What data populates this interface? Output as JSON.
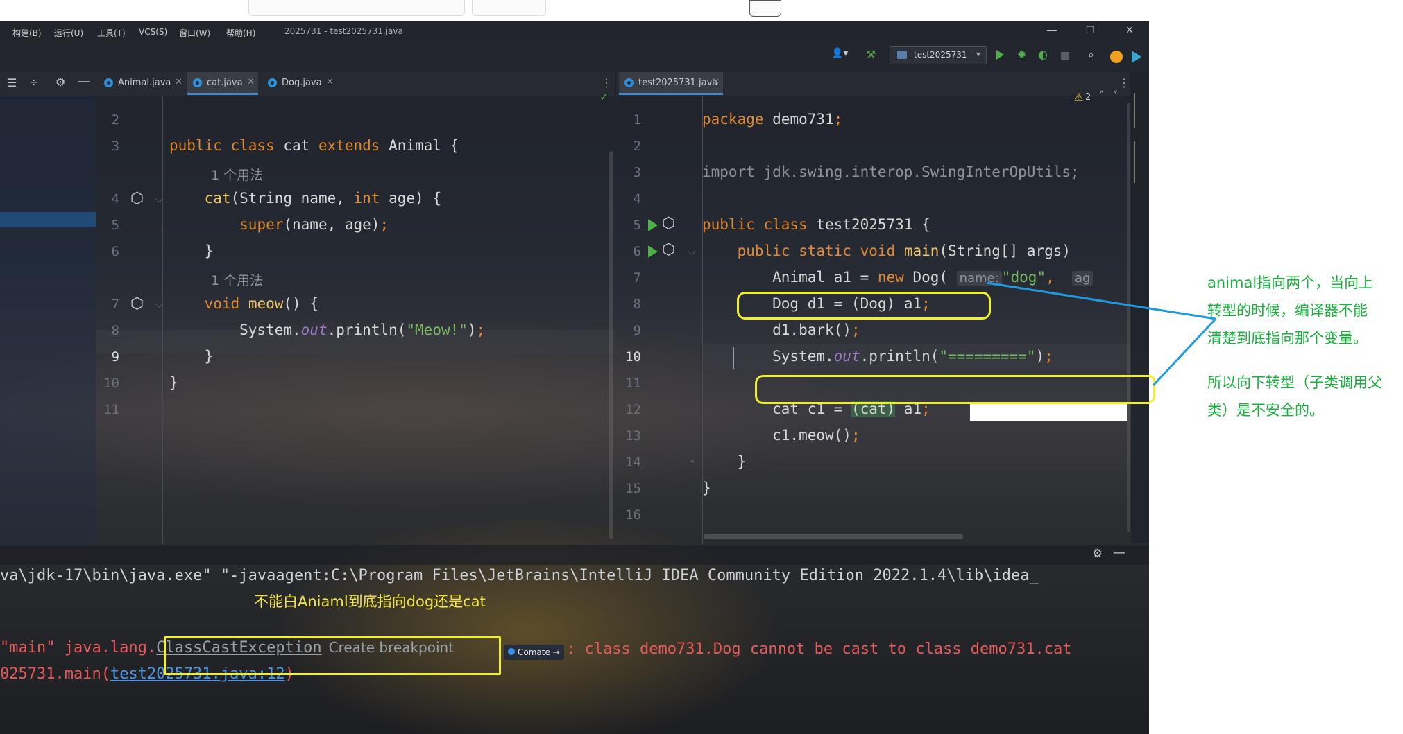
{
  "menu": [
    "构建(B)",
    "运行(U)",
    "工具(T)",
    "VCS(S)",
    "窗口(W)",
    "帮助(H)"
  ],
  "window_title": "2025731 - test2025731.java",
  "window_controls": {
    "minimize": "—",
    "restore": "❐",
    "close": "✕"
  },
  "toolbar": {
    "run_config": "test2025731",
    "user_icon": "👤▾"
  },
  "left_tabs": [
    {
      "label": "Animal.java",
      "active": false
    },
    {
      "label": "cat.java",
      "active": true
    },
    {
      "label": "Dog.java",
      "active": false
    }
  ],
  "right_tabs": [
    {
      "label": "test2025731.java",
      "active": true
    }
  ],
  "left_editor": {
    "line_numbers": [
      "2",
      "3",
      "",
      "4",
      "5",
      "6",
      "",
      "7",
      "8",
      "9",
      "10",
      "11"
    ],
    "usage_hint_1": "1 个用法",
    "usage_hint_2": "1 个用法"
  },
  "right_editor": {
    "line_numbers": [
      "1",
      "2",
      "3",
      "4",
      "5",
      "6",
      "7",
      "8",
      "9",
      "10",
      "11",
      "12",
      "13",
      "14",
      "15",
      "16"
    ],
    "warning_count": "2",
    "inlay_name": "name:",
    "inlay_age": "ag"
  },
  "console": {
    "cmd_line": "va\\jdk-17\\bin\\java.exe\" \"-javaagent:C:\\Program Files\\JetBrains\\IntelliJ IDEA Community Edition 2022.1.4\\lib\\idea_",
    "note_cn": "不能白Aniaml到底指向dog还是cat",
    "exc_prefix": "\"main\" java.lang.",
    "exc_name": "ClassCastException",
    "create_breakpoint": "Create breakpoint",
    "comate": "Comate →",
    "exc_msg": ": class demo731.Dog cannot be cast to class demo731.cat",
    "trace_prefix": "025731.main(",
    "trace_link": "test2025731.java:12",
    "trace_suffix": ")"
  },
  "annotation": {
    "line1": "animal指向两个，当向上",
    "line2": "转型的时候，编译器不能",
    "line3": "清楚到底指向那个变量。",
    "line4": "所以向下转型（子类调用父",
    "line5": "类）是不安全的。"
  },
  "colors": {
    "keyword": "#e2892f",
    "string": "#79bb63",
    "highlight_box": "#f2f026",
    "annotation": "#17b23c",
    "arrow": "#1e9be0",
    "error": "#e85a5a",
    "link": "#4a95e8"
  }
}
